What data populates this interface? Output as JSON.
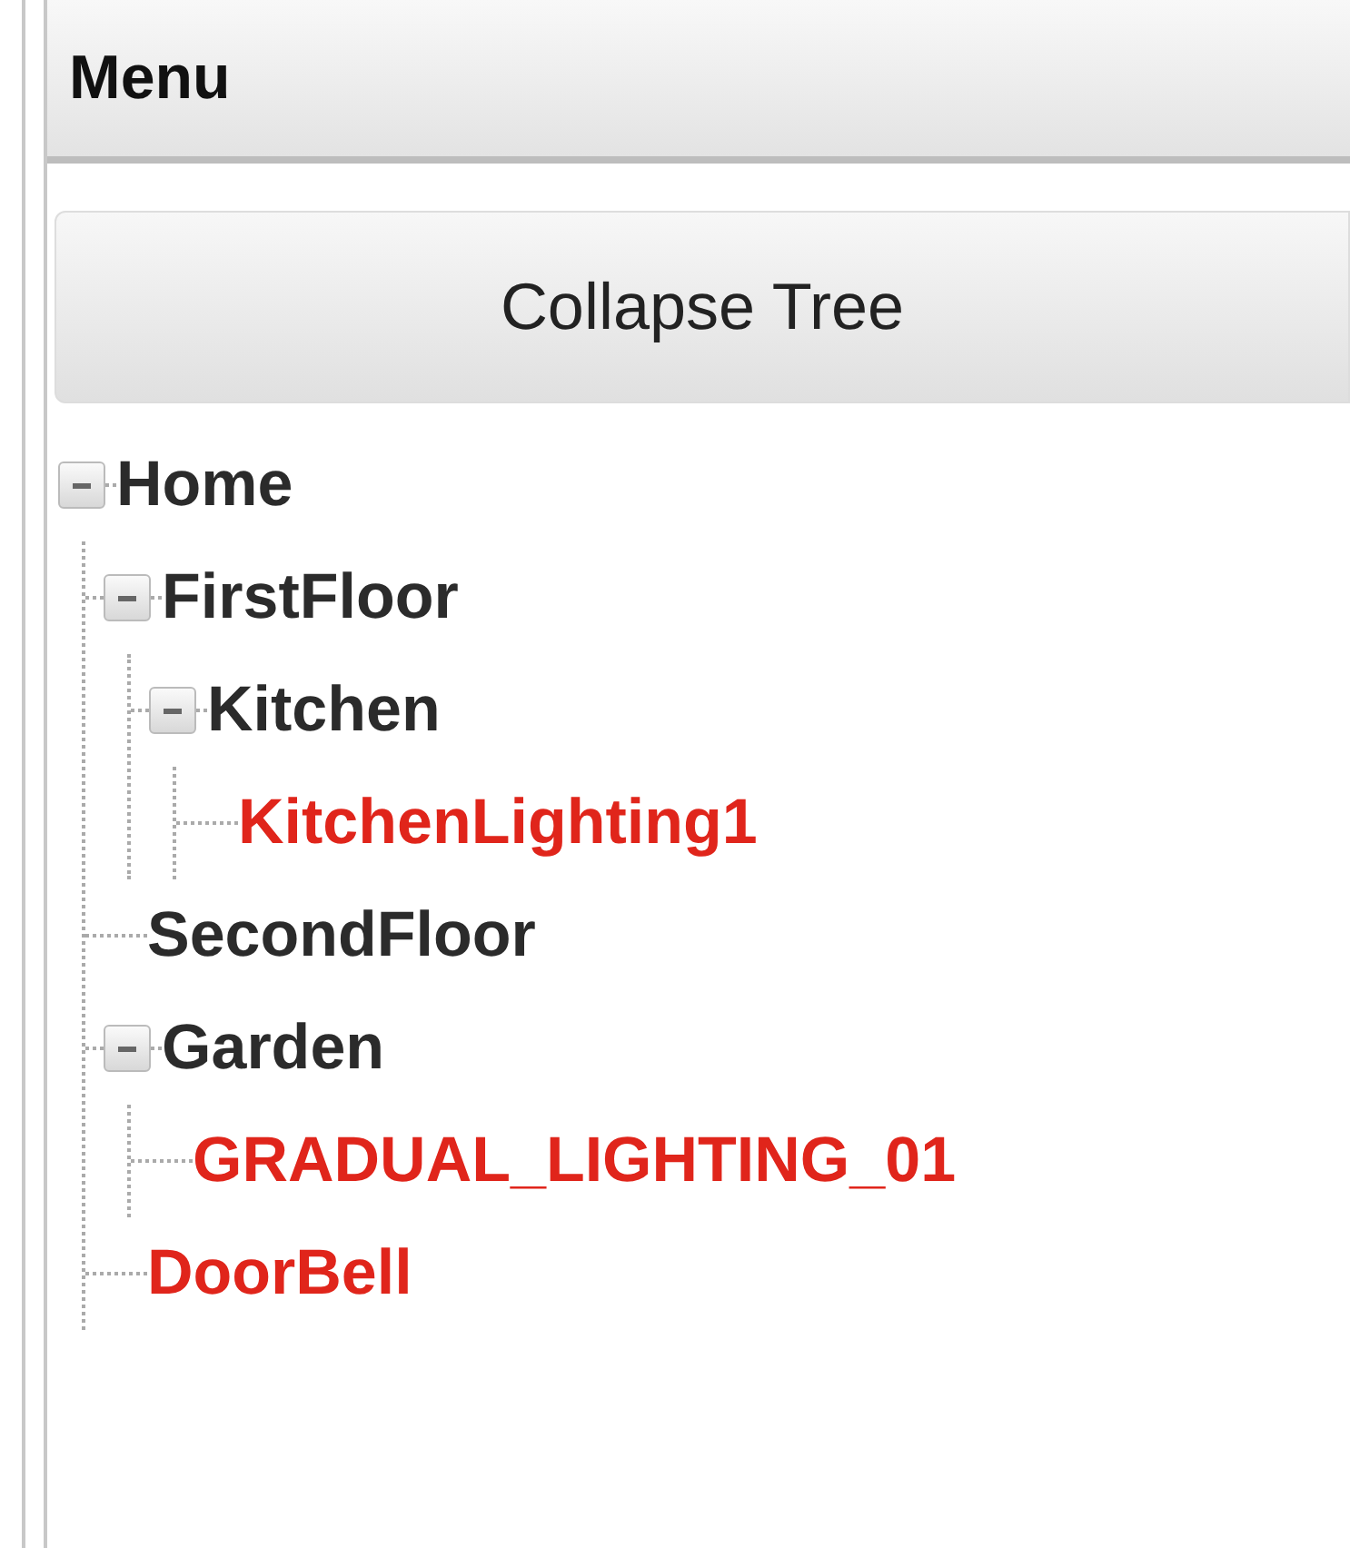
{
  "panel": {
    "title": "Menu"
  },
  "collapse_button": {
    "label": "Collapse Tree"
  },
  "tree": [
    {
      "label": "Home",
      "kind": "group",
      "expanded": true,
      "children": [
        {
          "label": "FirstFloor",
          "kind": "group",
          "expanded": true,
          "children": [
            {
              "label": "Kitchen",
              "kind": "group",
              "expanded": true,
              "children": [
                {
                  "label": "KitchenLighting1",
                  "kind": "device"
                }
              ]
            }
          ]
        },
        {
          "label": "SecondFloor",
          "kind": "group"
        },
        {
          "label": "Garden",
          "kind": "group",
          "expanded": true,
          "children": [
            {
              "label": "GRADUAL_LIGHTING_01",
              "kind": "device"
            }
          ]
        },
        {
          "label": "DoorBell",
          "kind": "device"
        }
      ]
    }
  ]
}
